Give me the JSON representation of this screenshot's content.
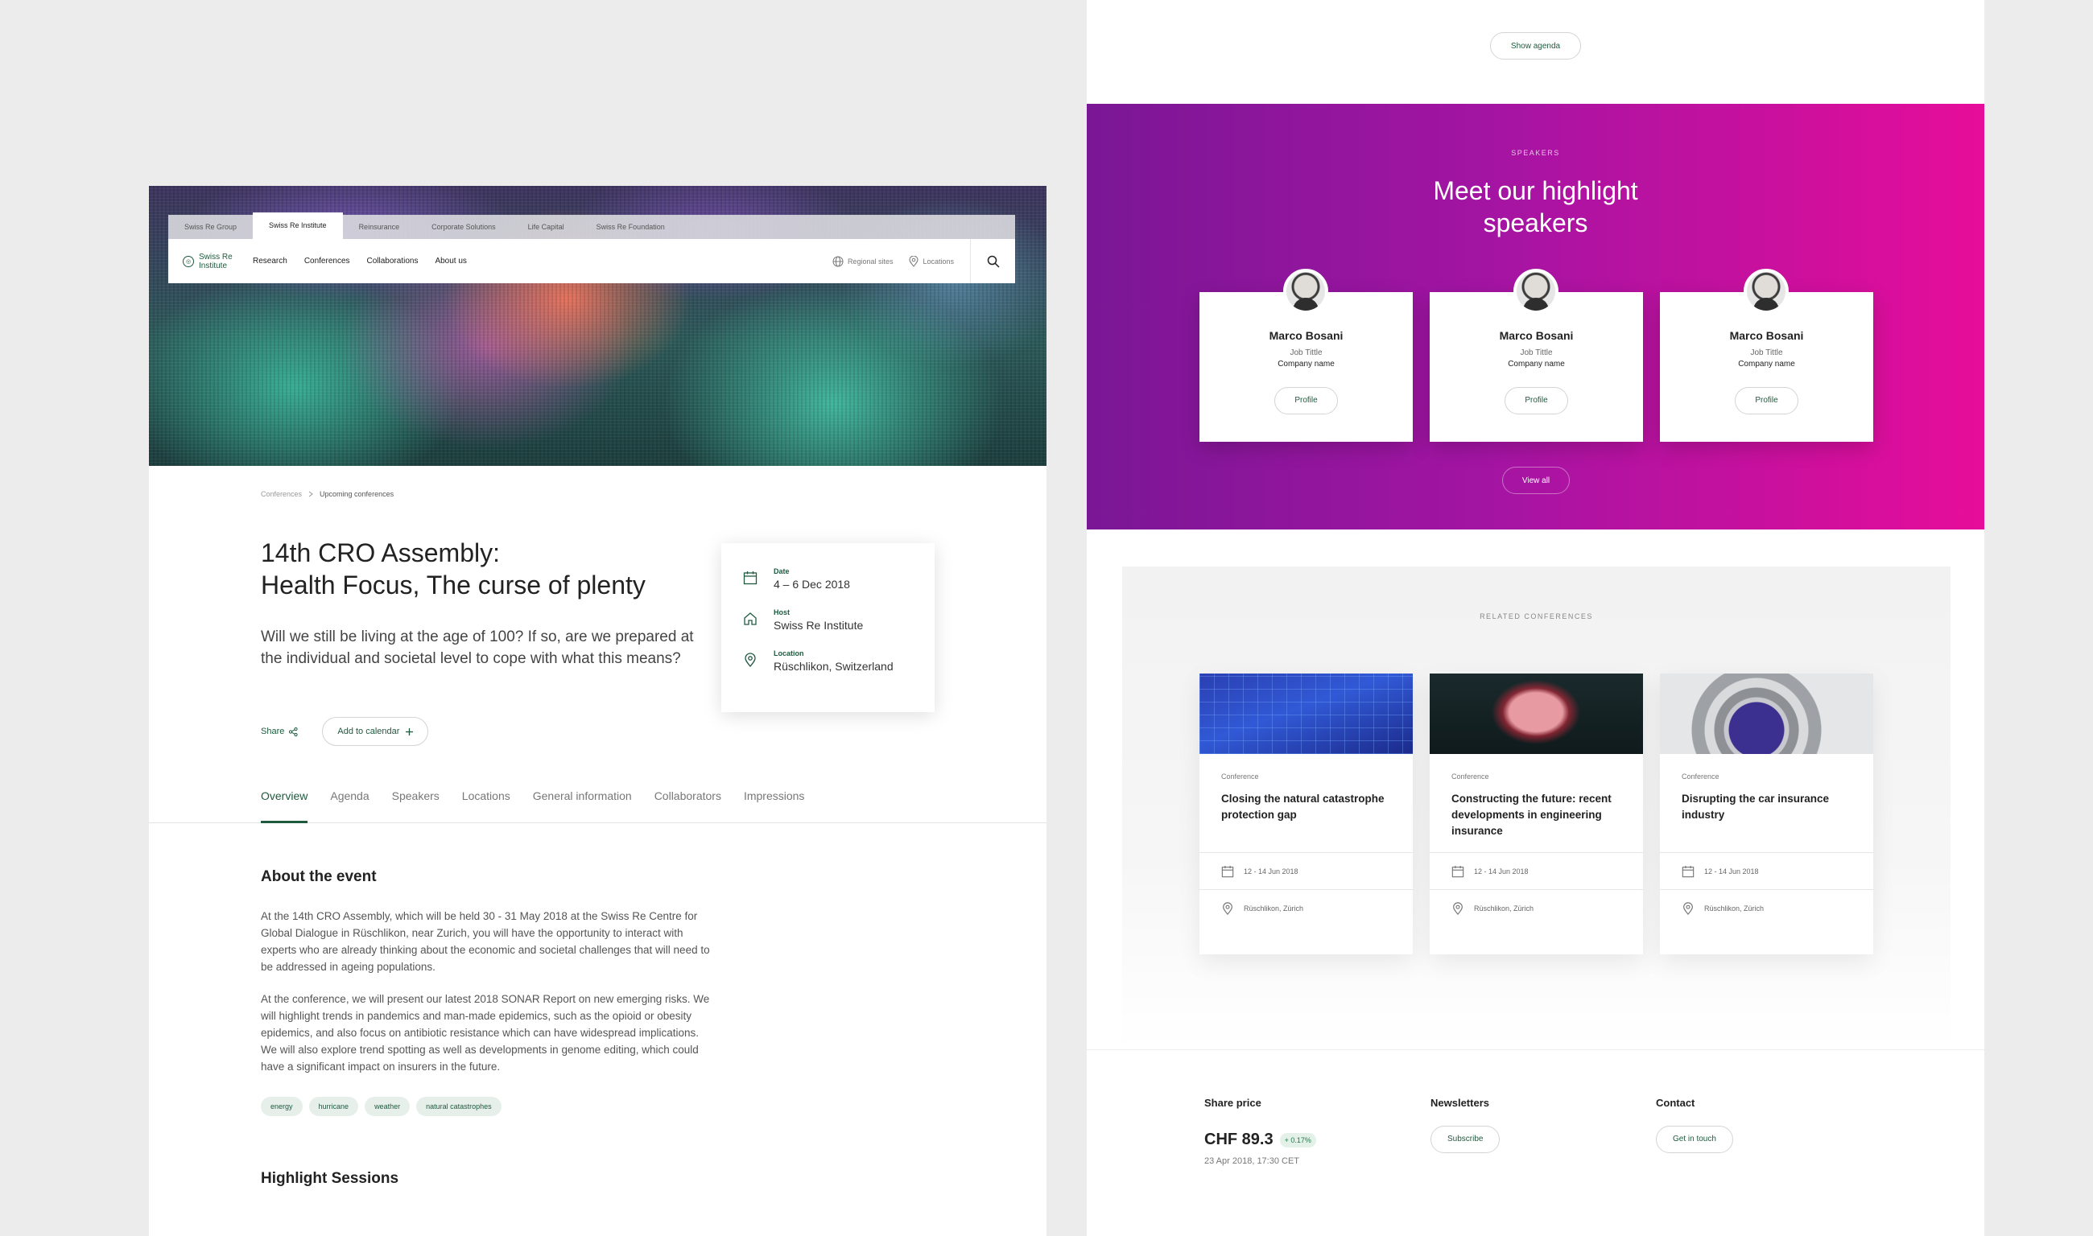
{
  "left": {
    "top_nav": [
      "Swiss Re Group",
      "Swiss Re Institute",
      "Reinsurance",
      "Corporate Solutions",
      "Life Capital",
      "Swiss Re Foundation"
    ],
    "brand": {
      "name": "Swiss Re",
      "sub": "Institute"
    },
    "main_nav": [
      "Research",
      "Conferences",
      "Collaborations",
      "About us"
    ],
    "utils": {
      "regional": "Regional sites",
      "locations": "Locations"
    },
    "breadcrumb": {
      "parent": "Conferences",
      "current": "Upcoming conferences"
    },
    "title_line1": "14th CRO Assembly:",
    "title_line2": "Health Focus, The curse of plenty",
    "intro": "Will we still be living at the age of 100? If so, are we prepared at the individual and societal level to cope with what this means?",
    "share_label": "Share",
    "add_calendar": "Add to calendar",
    "info": {
      "date_label": "Date",
      "date_value": "4 – 6 Dec 2018",
      "host_label": "Host",
      "host_value": "Swiss Re Institute",
      "location_label": "Location",
      "location_value": "Rüschlikon, Switzerland"
    },
    "tabs": [
      "Overview",
      "Agenda",
      "Speakers",
      "Locations",
      "General information",
      "Collaborators",
      "Impressions"
    ],
    "about_title": "About the event",
    "about_p1": "At the 14th CRO Assembly, which will be held 30 - 31 May 2018 at the Swiss Re Centre for Global Dialogue in Rüschlikon, near Zurich, you will have the opportunity to interact with experts who are already thinking about the economic and societal challenges that will need to be addressed in ageing populations.",
    "about_p2": "At the conference, we will present our latest 2018 SONAR Report on new emerging risks. We will highlight trends in pandemics and man-made epidemics, such as the opioid or obesity epidemics, and also focus on antibiotic resistance which can have widespread implications. We will also explore trend spotting as well as developments in genome editing, which could have a significant impact on insurers in the future.",
    "tags": [
      "energy",
      "hurricane",
      "weather",
      "natural catastrophes"
    ],
    "sessions_title": "Highlight Sessions"
  },
  "right": {
    "show_agenda": "Show agenda",
    "speakers_kicker": "SPEAKERS",
    "speakers_title_line1": "Meet our highlight",
    "speakers_title_line2": "speakers",
    "speakers": [
      {
        "name": "Marco Bosani",
        "job": "Job Tittle",
        "company": "Company name",
        "profile": "Profile"
      },
      {
        "name": "Marco Bosani",
        "job": "Job Tittle",
        "company": "Company name",
        "profile": "Profile"
      },
      {
        "name": "Marco Bosani",
        "job": "Job Tittle",
        "company": "Company name",
        "profile": "Profile"
      }
    ],
    "view_all": "View all",
    "related_kicker": "RELATED CONFERENCES",
    "related": [
      {
        "kicker": "Conference",
        "title": "Closing the natural catastrophe protection gap",
        "date": "12 - 14 Jun 2018",
        "location": "Rüschlikon, Zürich"
      },
      {
        "kicker": "Conference",
        "title": "Constructing the future: recent developments in engineering insurance",
        "date": "12 - 14 Jun 2018",
        "location": "Rüschlikon, Zürich"
      },
      {
        "kicker": "Conference",
        "title": "Disrupting the car insurance industry",
        "date": "12 - 14 Jun 2018",
        "location": "Rüschlikon, Zürich"
      }
    ],
    "footer": {
      "share_title": "Share price",
      "share_price": "CHF 89.3",
      "share_change": "+ 0.17%",
      "share_date": "23 Apr 2018, 17:30 CET",
      "newsletters_title": "Newsletters",
      "subscribe": "Subscribe",
      "contact_title": "Contact",
      "get_in_touch": "Get in touch"
    }
  }
}
